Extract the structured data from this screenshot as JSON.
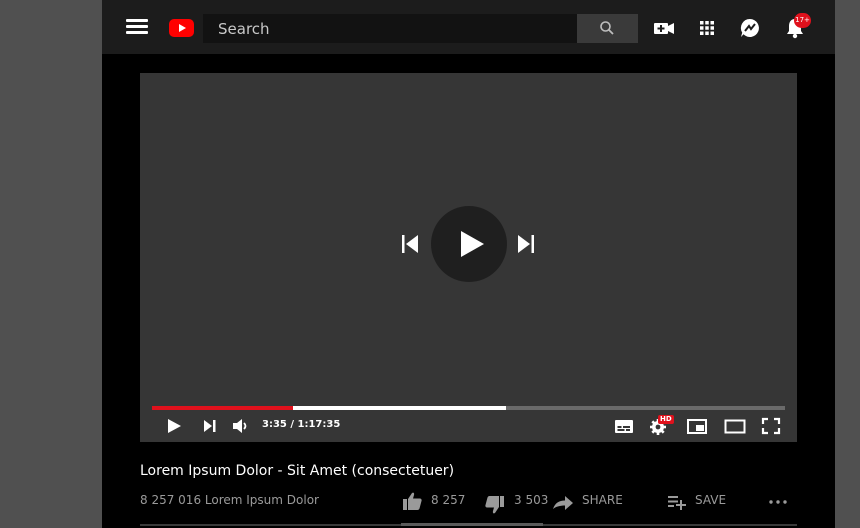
{
  "header": {
    "search_placeholder": "Search",
    "notification_badge": "17+"
  },
  "player": {
    "current_time": "3:35",
    "duration": "1:17:35",
    "time_display": "3:35 / 1:17:35",
    "played_fraction": 0.222,
    "buffered_fraction": 0.559,
    "hd_badge": "HD"
  },
  "video": {
    "title": "Lorem Ipsum Dolor - Sit Amet (consectetuer)",
    "views_line": "8 257 016 Lorem Ipsum Dolor",
    "likes": "8 257",
    "dislikes": "3 503",
    "share_label": "SHARE",
    "save_label": "SAVE"
  },
  "colors": {
    "accent": "#e0111c",
    "logo": "#ff0000",
    "topbar": "#1c1c1c",
    "player_bg": "#363636"
  },
  "icons": [
    "menu-icon",
    "youtube-logo",
    "search-icon",
    "create-video-icon",
    "apps-grid-icon",
    "messages-icon",
    "bell-icon",
    "skip-previous-icon",
    "play-icon",
    "skip-next-icon",
    "volume-icon",
    "subtitles-icon",
    "settings-icon",
    "miniplayer-icon",
    "theater-icon",
    "fullscreen-icon",
    "thumb-up-icon",
    "thumb-down-icon",
    "share-icon",
    "playlist-add-icon",
    "more-icon"
  ]
}
